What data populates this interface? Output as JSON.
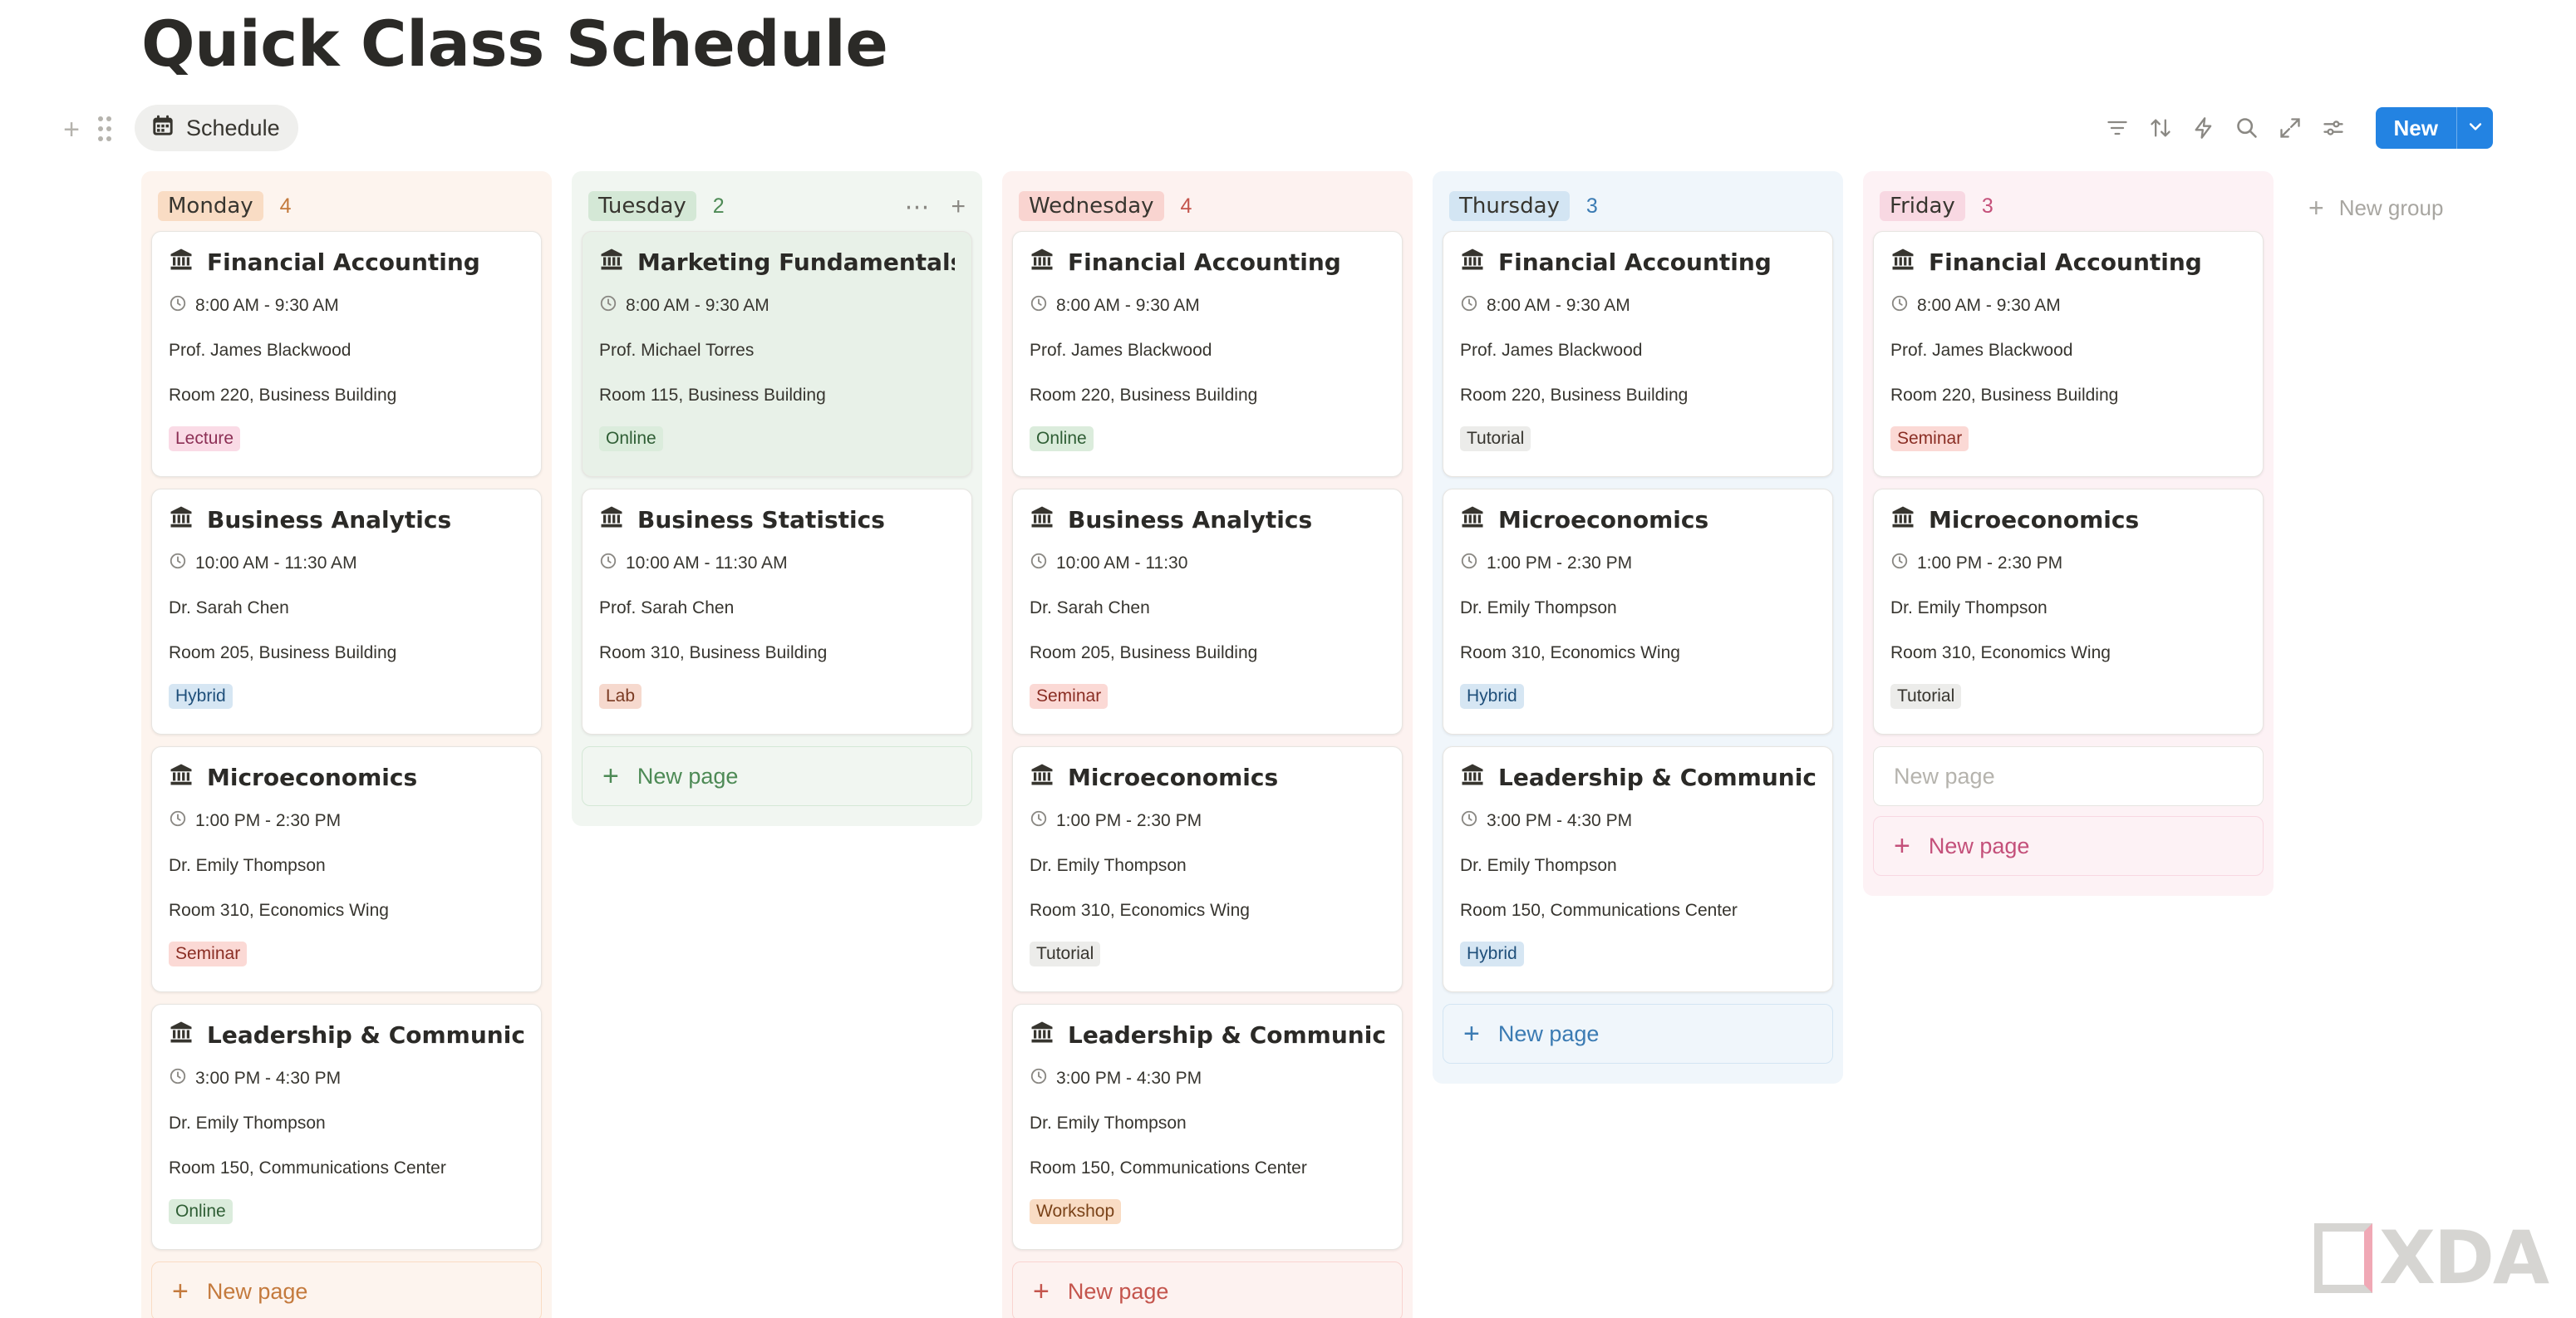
{
  "page": {
    "title": "Quick Class Schedule"
  },
  "toolbar": {
    "view_tab_label": "Schedule",
    "new_label": "New"
  },
  "new_group_label": "New group",
  "new_page_label": "New page",
  "watermark": "XDA",
  "columns": [
    {
      "name": "Monday",
      "count": "4",
      "colors": {
        "bg": "#fdf4ee",
        "pill": "#f9dcc4",
        "accent": "#c47a3d"
      },
      "cards": [
        {
          "title": "Financial Accounting",
          "time": "8:00 AM - 9:30 AM",
          "instructor": "Prof. James Blackwood",
          "room": "Room 220, Business Building",
          "tag": "Lecture"
        },
        {
          "title": "Business Analytics",
          "time": "10:00 AM - 11:30 AM",
          "instructor": "Dr. Sarah Chen",
          "room": "Room 205, Business Building",
          "tag": "Hybrid"
        },
        {
          "title": "Microeconomics",
          "time": "1:00 PM - 2:30 PM",
          "instructor": "Dr. Emily Thompson",
          "room": "Room 310, Economics Wing",
          "tag": "Seminar"
        },
        {
          "title": "Leadership & Communication",
          "time": "3:00 PM - 4:30 PM",
          "instructor": "Dr. Emily Thompson",
          "room": "Room 150, Communications Center",
          "tag": "Online"
        }
      ]
    },
    {
      "name": "Tuesday",
      "count": "2",
      "colors": {
        "bg": "#f1f6f1",
        "pill": "#d4e8d6",
        "accent": "#4d8a55"
      },
      "cards": [
        {
          "title": "Marketing Fundamentals",
          "time": "8:00 AM - 9:30 AM",
          "instructor": "Prof. Michael Torres",
          "room": "Room 115, Business Building",
          "tag": "Online"
        },
        {
          "title": "Business Statistics",
          "time": "10:00 AM - 11:30 AM",
          "instructor": "Prof. Sarah Chen",
          "room": "Room 310, Business Building",
          "tag": "Lab"
        }
      ]
    },
    {
      "name": "Wednesday",
      "count": "4",
      "colors": {
        "bg": "#fdf2f0",
        "pill": "#f9d4d0",
        "accent": "#c4554d"
      },
      "cards": [
        {
          "title": "Financial Accounting",
          "time": "8:00 AM - 9:30 AM",
          "instructor": "Prof. James Blackwood",
          "room": "Room 220, Business Building",
          "tag": "Online"
        },
        {
          "title": "Business Analytics",
          "time": "10:00 AM - 11:30",
          "instructor": "Dr. Sarah Chen",
          "room": "Room 205, Business Building",
          "tag": "Seminar"
        },
        {
          "title": "Microeconomics",
          "time": "1:00 PM - 2:30 PM",
          "instructor": "Dr. Emily Thompson",
          "room": "Room 310, Economics Wing",
          "tag": "Tutorial"
        },
        {
          "title": "Leadership & Communication",
          "time": "3:00 PM - 4:30 PM",
          "instructor": "Dr. Emily Thompson",
          "room": "Room 150, Communications Center",
          "tag": "Workshop"
        }
      ]
    },
    {
      "name": "Thursday",
      "count": "3",
      "colors": {
        "bg": "#f0f6fb",
        "pill": "#d3e5f3",
        "accent": "#3b7bb3"
      },
      "cards": [
        {
          "title": "Financial Accounting",
          "time": "8:00 AM - 9:30 AM",
          "instructor": "Prof. James Blackwood",
          "room": "Room 220, Business Building",
          "tag": "Tutorial"
        },
        {
          "title": "Microeconomics",
          "time": "1:00 PM - 2:30 PM",
          "instructor": "Dr. Emily Thompson",
          "room": "Room 310, Economics Wing",
          "tag": "Hybrid"
        },
        {
          "title": "Leadership & Communication",
          "time": "3:00 PM - 4:30 PM",
          "instructor": "Dr. Emily Thompson",
          "room": "Room 150, Communications Center",
          "tag": "Hybrid"
        }
      ]
    },
    {
      "name": "Friday",
      "count": "3",
      "colors": {
        "bg": "#fdf2f5",
        "pill": "#f8d8e2",
        "accent": "#c4507a"
      },
      "cards": [
        {
          "title": "Financial Accounting",
          "time": "8:00 AM - 9:30 AM",
          "instructor": "Prof. James Blackwood",
          "room": "Room 220, Business Building",
          "tag": "Seminar"
        },
        {
          "title": "Microeconomics",
          "time": "1:00 PM - 2:30 PM",
          "instructor": "Dr. Emily Thompson",
          "room": "Room 310, Economics Wing",
          "tag": "Tutorial"
        }
      ],
      "placeholder_card": "New page"
    }
  ],
  "tag_colors": {
    "Lecture": {
      "bg": "#fadbe6",
      "fg": "#8c2f55"
    },
    "Hybrid": {
      "bg": "#d6e6f3",
      "fg": "#1f4f7a"
    },
    "Seminar": {
      "bg": "#fbd9d5",
      "fg": "#8a2e24"
    },
    "Online": {
      "bg": "#dbecdc",
      "fg": "#2f5e35"
    },
    "Lab": {
      "bg": "#f6d9ce",
      "fg": "#7a3a22"
    },
    "Tutorial": {
      "bg": "#ececea",
      "fg": "#37352f"
    },
    "Workshop": {
      "bg": "#f9dcc4",
      "fg": "#7a4218"
    }
  }
}
